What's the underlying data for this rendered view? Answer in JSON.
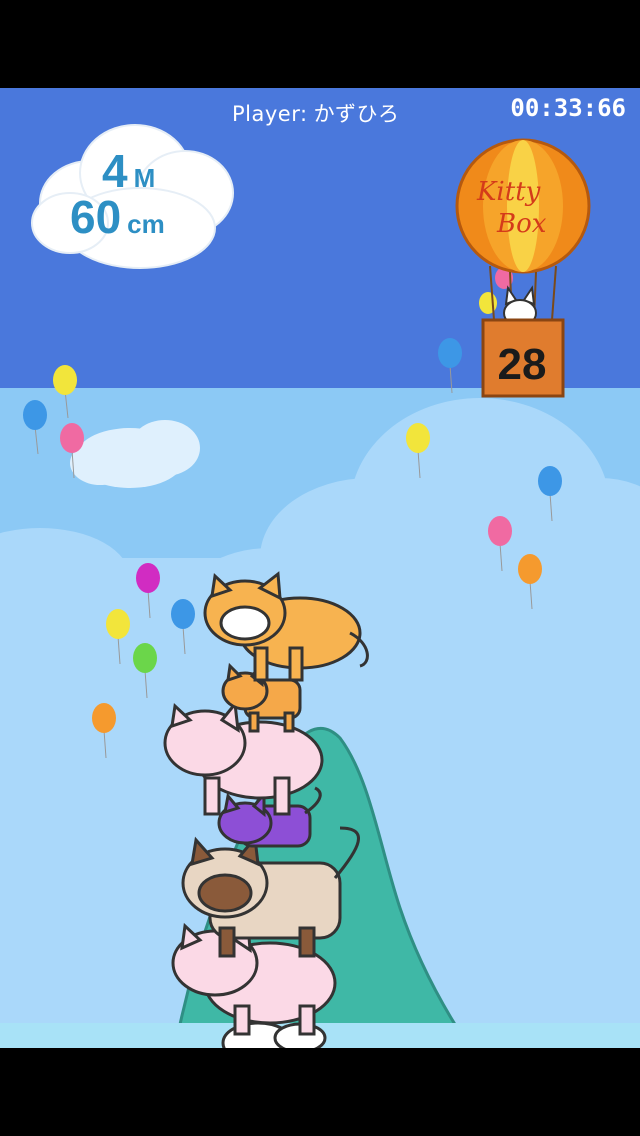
{
  "hud": {
    "player_label": "Player:",
    "player_name": "かずひろ",
    "timer": "00:33:66"
  },
  "height": {
    "meters": "4",
    "meters_unit": "M",
    "centimeters": "60",
    "centimeters_unit": "cm"
  },
  "balloon_goal": {
    "brand_line1": "Kitty",
    "brand_line2": "Box",
    "box_count": "28"
  },
  "cats": [
    "orange-tabby-cat",
    "small-orange-cat",
    "pink-cat",
    "purple-cat",
    "siamese-cat",
    "pink-cat",
    "white-cat"
  ],
  "colors": {
    "sky_top": "#4a78dc",
    "sky_bottom": "#8cc9f5",
    "mountain": "#3fb8a6",
    "height_text": "#2d8fc4",
    "balloon_orange": "#f08a1a"
  }
}
